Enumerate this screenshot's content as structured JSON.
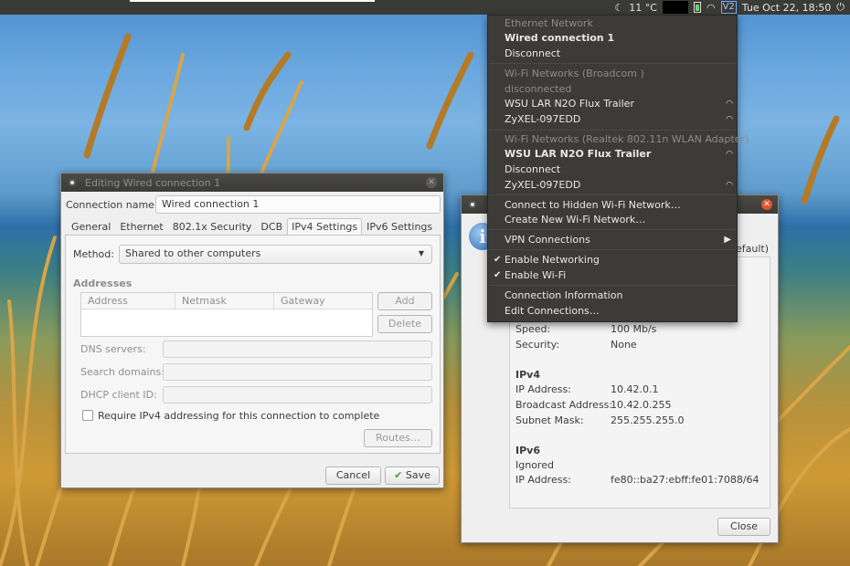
{
  "top_panel": {
    "weather": "11 °C",
    "vpn_badge": "V2",
    "clock": "Tue Oct 22, 18:50",
    "moon_icon": "moon-icon",
    "power_icon": "power-icon"
  },
  "editor": {
    "title": "Editing Wired connection 1",
    "connection_name_label": "Connection name:",
    "connection_name": "Wired connection 1",
    "tabs": [
      "General",
      "Ethernet",
      "802.1x Security",
      "DCB",
      "IPv4 Settings",
      "IPv6 Settings"
    ],
    "active_tab": "IPv4 Settings",
    "method_label": "Method:",
    "method_value": "Shared to other computers",
    "addresses_label": "Addresses",
    "address_columns": [
      "Address",
      "Netmask",
      "Gateway"
    ],
    "add_label": "Add",
    "delete_label": "Delete",
    "dns_label": "DNS servers:",
    "search_domains_label": "Search domains:",
    "dhcp_client_label": "DHCP client ID:",
    "require_ipv4_label": "Require IPv4 addressing for this connection to complete",
    "routes_label": "Routes…",
    "cancel_label": "Cancel",
    "save_label": "Save"
  },
  "info": {
    "header_partial": "efault)",
    "rows": [
      {
        "label": "Speed:",
        "value": "100 Mb/s"
      },
      {
        "label": "Security:",
        "value": "None"
      }
    ],
    "ipv4_heading": "IPv4",
    "ipv4_rows": [
      {
        "label": "IP Address:",
        "value": "10.42.0.1"
      },
      {
        "label": "Broadcast Address:",
        "value": "10.42.0.255"
      },
      {
        "label": "Subnet Mask:",
        "value": "255.255.255.0"
      }
    ],
    "ipv6_heading": "IPv6",
    "ipv6_ignored": "Ignored",
    "ipv6_address_label": "IP Address:",
    "ipv6_address": "fe80::ba27:ebff:fe01:7088/64",
    "close_label": "Close"
  },
  "menu": {
    "ethernet_header": "Ethernet Network",
    "wired_connection": "Wired connection 1",
    "disconnect_1": "Disconnect",
    "wifi_broadcom_header": "Wi-Fi Networks (Broadcom )",
    "broadcom_status": "disconnected",
    "broadcom_networks": [
      "WSU LAR N2O Flux Trailer",
      "ZyXEL-097EDD"
    ],
    "wifi_realtek_header": "Wi-Fi Networks (Realtek 802.11n WLAN Adapter)",
    "realtek_active": "WSU LAR N2O Flux Trailer",
    "disconnect_2": "Disconnect",
    "realtek_other": "ZyXEL-097EDD",
    "connect_hidden": "Connect to Hidden Wi-Fi Network…",
    "create_new": "Create New Wi-Fi Network…",
    "vpn_connections": "VPN Connections",
    "enable_networking": "Enable Networking",
    "enable_wifi": "Enable Wi-Fi",
    "connection_information": "Connection Information",
    "edit_connections": "Edit Connections…"
  }
}
